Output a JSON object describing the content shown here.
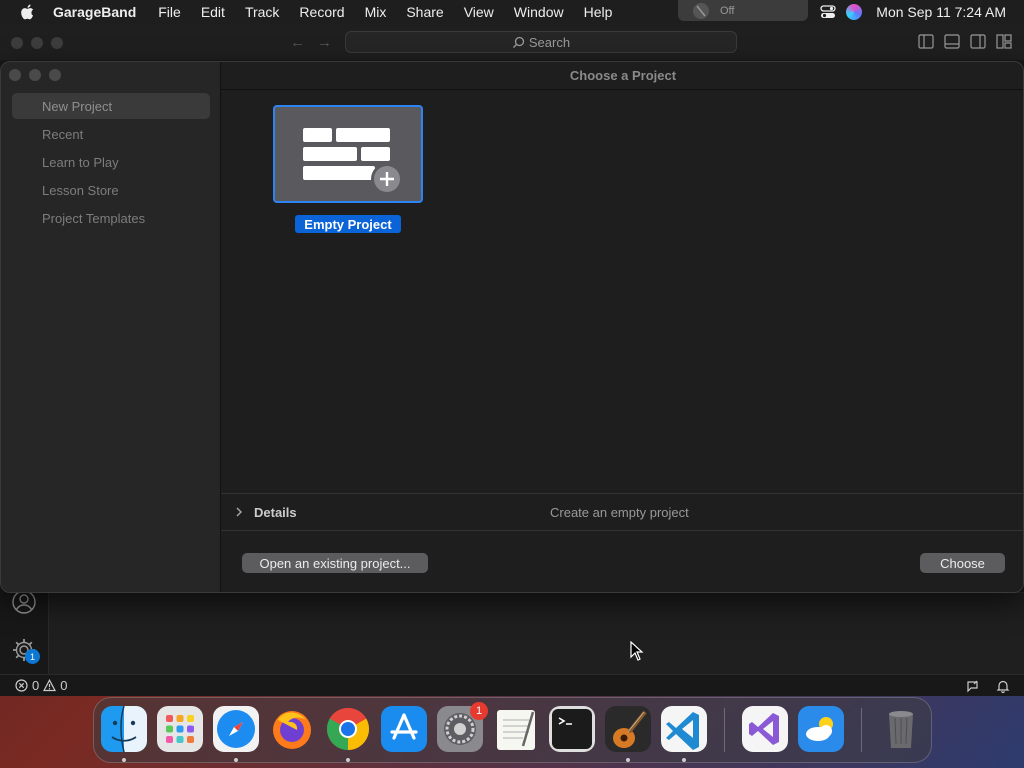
{
  "menubar": {
    "app_name": "GarageBand",
    "items": [
      "File",
      "Edit",
      "Track",
      "Record",
      "Mix",
      "Share",
      "View",
      "Window",
      "Help"
    ],
    "focus_status": "Off",
    "clock": "Mon Sep 11  7:24 AM"
  },
  "background_window": {
    "search_placeholder": "Search",
    "settings_badge": "1",
    "status_errors": "0",
    "status_warnings": "0"
  },
  "dialog": {
    "header_title": "Choose a Project",
    "sidebar": [
      {
        "label": "New Project",
        "selected": true
      },
      {
        "label": "Recent"
      },
      {
        "label": "Learn to Play"
      },
      {
        "label": "Lesson Store"
      },
      {
        "label": "Project Templates"
      }
    ],
    "tile_label": "Empty Project",
    "details_label": "Details",
    "details_description": "Create an empty project",
    "open_existing_label": "Open an existing project...",
    "choose_label": "Choose",
    "accent_color": "#0a64d8"
  },
  "dock": {
    "apps": [
      "finder-icon",
      "launchpad-icon",
      "safari-icon",
      "firefox-icon",
      "chrome-icon",
      "app-store-icon",
      "system-settings-icon",
      "textedit-icon",
      "terminal-icon",
      "garageband-icon",
      "vscode-icon",
      "visual-studio-icon",
      "weather-icon",
      "trash-icon"
    ],
    "settings_badge": "1"
  }
}
